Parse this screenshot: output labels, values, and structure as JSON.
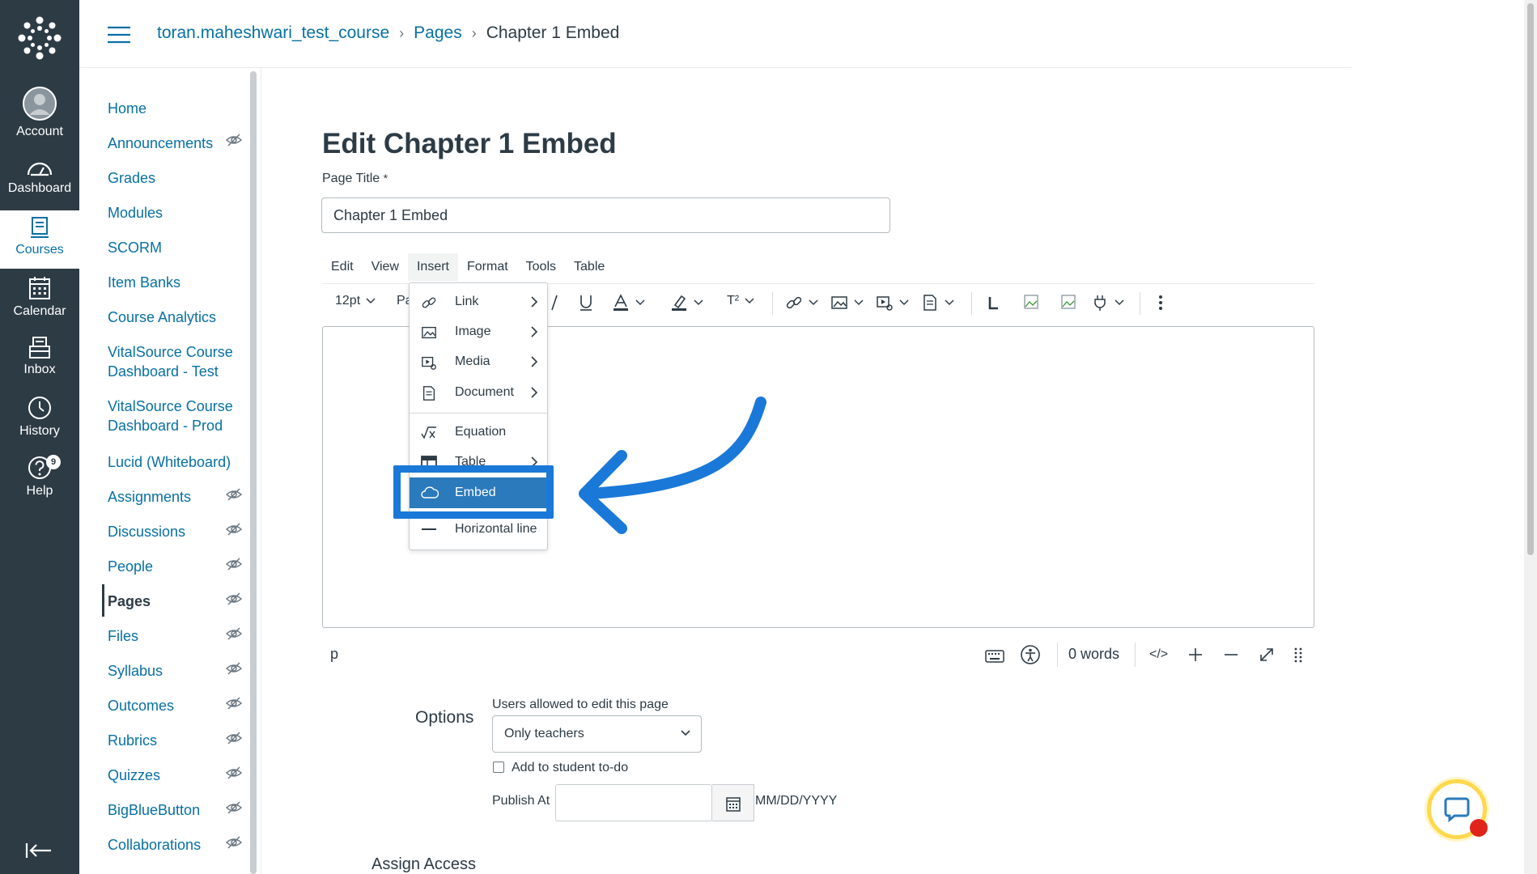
{
  "global_nav": {
    "account": "Account",
    "dashboard": "Dashboard",
    "courses": "Courses",
    "calendar": "Calendar",
    "inbox": "Inbox",
    "history": "History",
    "help": "Help",
    "help_badge": "9"
  },
  "breadcrumb": {
    "course": "toran.maheshwari_test_course",
    "section": "Pages",
    "current": "Chapter 1 Embed"
  },
  "course_nav": [
    {
      "label": "Home"
    },
    {
      "label": "Announcements"
    },
    {
      "label": "Grades"
    },
    {
      "label": "Modules"
    },
    {
      "label": "SCORM"
    },
    {
      "label": "Item Banks"
    },
    {
      "label": "Course Analytics"
    },
    {
      "label": "VitalSource Course Dashboard - Test"
    },
    {
      "label": "VitalSource Course Dashboard - Prod"
    },
    {
      "label": "Lucid (Whiteboard)"
    },
    {
      "label": "Assignments"
    },
    {
      "label": "Discussions"
    },
    {
      "label": "People"
    },
    {
      "label": "Pages"
    },
    {
      "label": "Files"
    },
    {
      "label": "Syllabus"
    },
    {
      "label": "Outcomes"
    },
    {
      "label": "Rubrics"
    },
    {
      "label": "Quizzes"
    },
    {
      "label": "BigBlueButton"
    },
    {
      "label": "Collaborations"
    }
  ],
  "page": {
    "heading": "Edit Chapter 1 Embed",
    "title_label": "Page Title",
    "required_mark": "*",
    "title_value": "Chapter 1 Embed"
  },
  "editor": {
    "menu": [
      "Edit",
      "View",
      "Insert",
      "Format",
      "Tools",
      "Table"
    ],
    "font_size": "12pt",
    "paragraph_partial": "Pa",
    "superscript_label": "T²",
    "path": "p",
    "word_count": "0 words",
    "html_toggle": "</>"
  },
  "insert_menu": {
    "items": [
      "Link",
      "Image",
      "Media",
      "Document",
      "Equation",
      "Table",
      "Embed",
      "Horizontal line"
    ],
    "highlighted": "Embed"
  },
  "options": {
    "title": "Options",
    "edit_label": "Users allowed to edit this page",
    "edit_value": "Only teachers",
    "todo_label": "Add to student to-do",
    "publish_label": "Publish At",
    "date_format": "MM/DD/YYYY",
    "assign_access": "Assign Access"
  },
  "colors": {
    "nav_bg": "#2d3b45",
    "link": "#0770a3",
    "highlight": "#1a79d8",
    "menu_highlight": "#2b7abc"
  }
}
